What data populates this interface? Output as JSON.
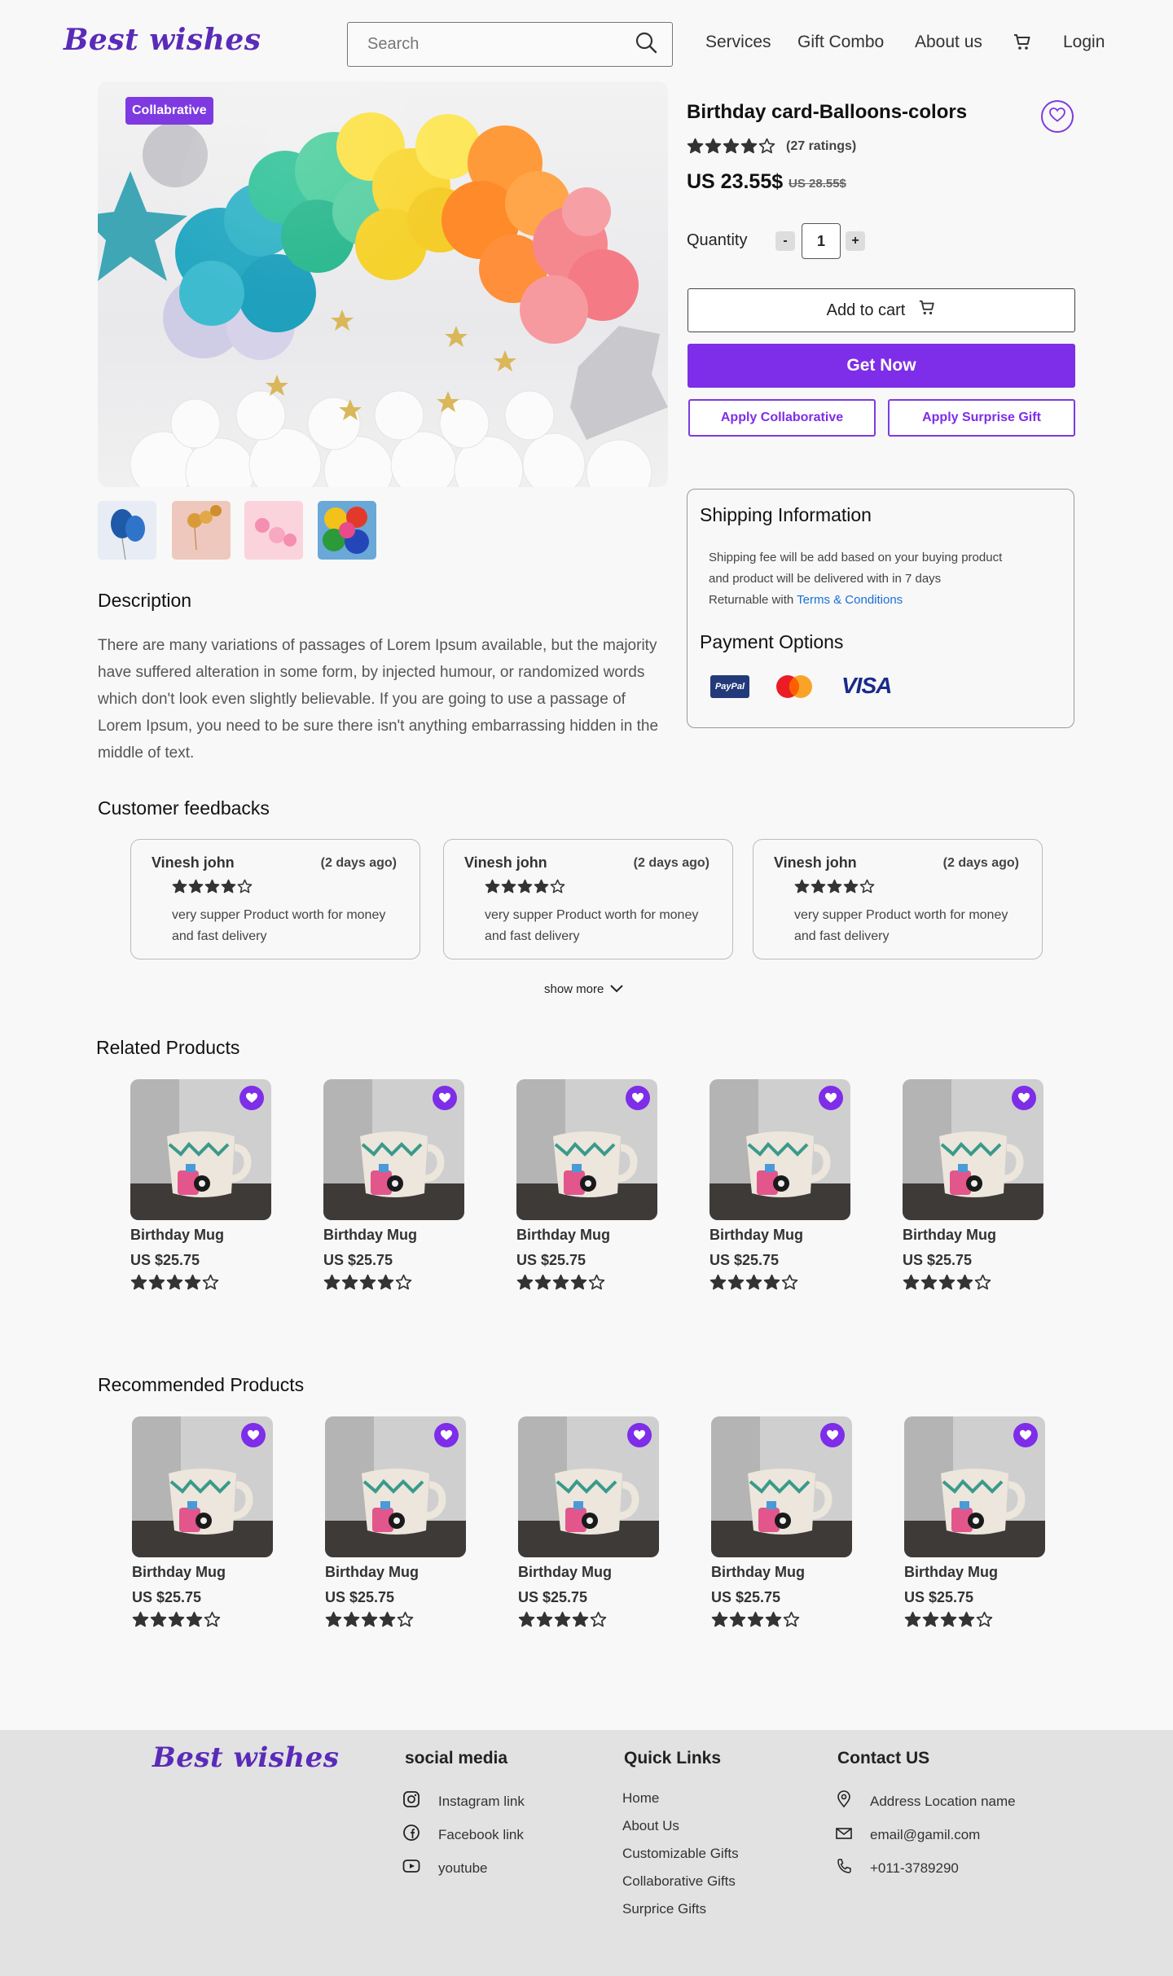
{
  "header": {
    "logo": "Best wishes",
    "search_placeholder": "Search",
    "nav": [
      "Services",
      "Gift Combo",
      "About us",
      "Login"
    ]
  },
  "product": {
    "badge": "Collabrative",
    "title": "Birthday card-Balloons-colors",
    "rating_stars": 4,
    "ratings_text": "(27 ratings)",
    "price": "US 23.55$",
    "old_price": "US 28.55$",
    "quantity_label": "Quantity",
    "quantity": "1",
    "minus": "-",
    "plus": "+",
    "add_to_cart": "Add to cart",
    "get_now": "Get Now",
    "apply_collab": "Apply Collaborative",
    "apply_surprise": "Apply Surprise Gift"
  },
  "shipping": {
    "title": "Shipping Information",
    "line1": "Shipping fee will be add based on your buying product",
    "line2": "and product will be delivered with in 7 days",
    "line3_prefix": "Returnable with ",
    "terms_link": "Terms & Conditions",
    "payment_title": "Payment Options",
    "paypal": "PayPal",
    "visa": "VISA"
  },
  "description": {
    "title": "Description",
    "text": "There are many variations of passages of Lorem Ipsum available, but the majority have suffered alteration in some form, by injected humour, or randomized words which don't look even slightly believable. If you are going to use a passage of Lorem Ipsum, you need to be sure there isn't anything embarrassing hidden in the middle of text."
  },
  "feedbacks": {
    "title": "Customer feedbacks",
    "items": [
      {
        "name": "Vinesh john",
        "time": "(2 days ago)",
        "stars": 4,
        "text": "very supper Product worth for money and fast delivery"
      },
      {
        "name": "Vinesh john",
        "time": "(2 days ago)",
        "stars": 4,
        "text": "very supper Product worth for money and fast delivery"
      },
      {
        "name": "Vinesh john",
        "time": "(2 days ago)",
        "stars": 4,
        "text": "very supper Product worth for money and fast delivery"
      }
    ],
    "show_more": "show more"
  },
  "related": {
    "title": "Related Products",
    "items": [
      {
        "name": "Birthday Mug",
        "price": "US $25.75",
        "stars": 4
      },
      {
        "name": "Birthday Mug",
        "price": "US $25.75",
        "stars": 4
      },
      {
        "name": "Birthday Mug",
        "price": "US $25.75",
        "stars": 4
      },
      {
        "name": "Birthday Mug",
        "price": "US $25.75",
        "stars": 4
      },
      {
        "name": "Birthday Mug",
        "price": "US $25.75",
        "stars": 4
      }
    ]
  },
  "recommended": {
    "title": "Recommended Products",
    "items": [
      {
        "name": "Birthday Mug",
        "price": "US $25.75",
        "stars": 4
      },
      {
        "name": "Birthday Mug",
        "price": "US $25.75",
        "stars": 4
      },
      {
        "name": "Birthday Mug",
        "price": "US $25.75",
        "stars": 4
      },
      {
        "name": "Birthday Mug",
        "price": "US $25.75",
        "stars": 4
      },
      {
        "name": "Birthday Mug",
        "price": "US $25.75",
        "stars": 4
      }
    ]
  },
  "footer": {
    "logo": "Best wishes",
    "social_title": "social media",
    "social": [
      "Instagram link",
      "Facebook link",
      "youtube"
    ],
    "quick_title": "Quick Links",
    "quick": [
      "Home",
      "About Us",
      "Customizable Gifts",
      "Collaborative Gifts",
      "Surprice Gifts"
    ],
    "contact_title": "Contact US",
    "contact": [
      "Address Location name",
      "email@gamil.com",
      "+011-3789290"
    ]
  },
  "colors": {
    "accent": "#7e2de8",
    "logo": "#5a2bb8",
    "link": "#1a6fd8",
    "footer_bg": "#e2e2e2"
  }
}
